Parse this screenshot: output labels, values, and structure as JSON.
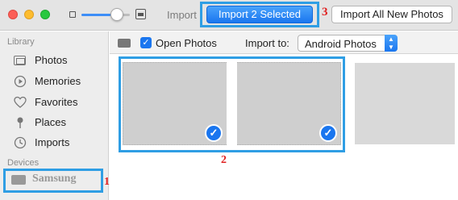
{
  "toolbar": {
    "import_label": "Import",
    "import_selected_label": "Import 2 Selected",
    "import_all_label": "Import All New Photos"
  },
  "zoom": {
    "level": 0.6
  },
  "sidebar": {
    "library_header": "Library",
    "items": [
      {
        "label": "Photos",
        "icon": "photos-icon"
      },
      {
        "label": "Memories",
        "icon": "memories-icon"
      },
      {
        "label": "Favorites",
        "icon": "heart-icon"
      },
      {
        "label": "Places",
        "icon": "pin-icon"
      },
      {
        "label": "Imports",
        "icon": "clock-icon"
      }
    ],
    "devices_header": "Devices",
    "device": {
      "label": "Samsung",
      "icon": "device-icon"
    }
  },
  "options": {
    "open_photos_label": "Open Photos",
    "open_photos_checked": true,
    "import_to_label": "Import to:",
    "import_to_value": "Android Photos"
  },
  "annotations": {
    "step1": "1",
    "step2": "2",
    "step3": "3"
  },
  "colors": {
    "accent": "#1a76ef",
    "highlight": "#2f9ee4",
    "annotation": "#e02020"
  }
}
